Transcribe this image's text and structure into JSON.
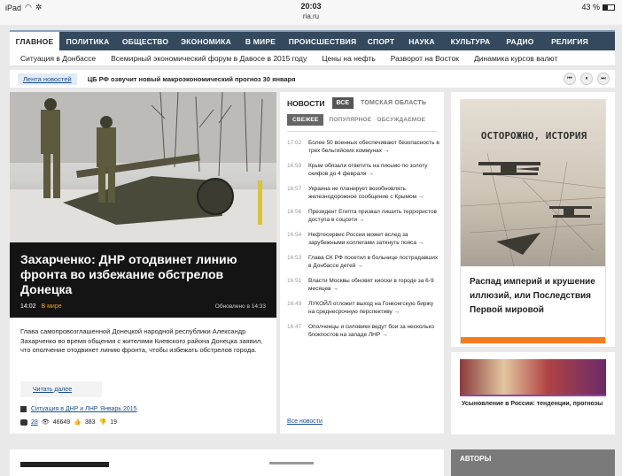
{
  "status_bar": {
    "device": "iPad",
    "time": "20:03",
    "url": "ria.ru",
    "battery": "43 %"
  },
  "main_nav": [
    {
      "label": "ГЛАВНОЕ",
      "active": true
    },
    {
      "label": "ПОЛИТИКА"
    },
    {
      "label": "ОБЩЕСТВО"
    },
    {
      "label": "ЭКОНОМИКА"
    },
    {
      "label": "В МИРЕ"
    },
    {
      "label": "ПРОИСШЕСТВИЯ"
    },
    {
      "label": "СПОРТ"
    },
    {
      "label": "НАУКА"
    },
    {
      "label": "КУЛЬТУРА"
    },
    {
      "label": "РАДИО"
    },
    {
      "label": "РЕЛИГИЯ"
    }
  ],
  "sub_nav": [
    "Ситуация в Донбассе",
    "Всемирный экономический форум в Давосе в 2015 году",
    "Цены на нефть",
    "Разворот на Восток",
    "Динамика курсов валют"
  ],
  "ticker": {
    "tab_label": "Лента новостей",
    "headline": "ЦБ РФ озвучит новый макроэкономический прогноз 30 января"
  },
  "lead_story": {
    "title": "Захарченко: ДНР отодвинет линию фронта во избежание обстрелов Донецка",
    "time": "14:02",
    "rubric": "В мире",
    "updated": "Обновлено в 14:33",
    "summary": "Глава самопровозглашенной Донецкой народной республики Александр Захарченко во время общения с жителями Киевского района Донецка заявил, что ополчение отодвинет линию фронта, чтобы избежать обстрелов города.",
    "read_more": "Читать далее",
    "story_link": "Ситуация в ДНР и ЛНР. Январь 2015",
    "comments": "28",
    "views": "46649",
    "likes": "383",
    "dislikes": "19"
  },
  "news_column": {
    "title": "НОВОСТИ",
    "all_label": "ВСЕ",
    "region_label": "ТОМСКАЯ ОБЛАСТЬ",
    "filters": [
      "СВЕЖЕЕ",
      "ПОПУЛЯРНОЕ",
      "ОБСУЖДАЕМОЕ"
    ],
    "items": [
      {
        "time": "17:02",
        "text": "Более 50 военных обеспечивают безопасность в трех бельгийских коммунах →"
      },
      {
        "time": "16:59",
        "text": "Крым обязали ответить на письмо по золоту скифов до 4 февраля →"
      },
      {
        "time": "16:57",
        "text": "Украина не планирует возобновлять железнодорожное сообщение с Крымом →"
      },
      {
        "time": "16:56",
        "text": "Президент Египта призвал лишить террористов доступа в соцсети →"
      },
      {
        "time": "16:54",
        "text": "Нефтесервис России может вслед за зарубежными коллегами затянуть пояса →"
      },
      {
        "time": "16:53",
        "text": "Глава СК РФ посетил в больнице пострадавших в Донбассе детей →"
      },
      {
        "time": "16:51",
        "text": "Власти Москвы обновят киоски в городе за 6-9 месяцев →"
      },
      {
        "time": "16:49",
        "text": "ЛУКОЙЛ отложит выход на Гонконгскую биржу на среднесрочную перспективу →"
      },
      {
        "time": "16:47",
        "text": "Ополченцы и силовики ведут бои за несколько блокпостов на западе ЛНР →"
      }
    ],
    "all_news": "Все новости"
  },
  "ad": {
    "heading": "ОСТОРОЖНО, ИСТОРИЯ",
    "body": "Распад империй и крушение иллюзий, или Последствия Первой мировой"
  },
  "promo": {
    "caption": "Усыновление в России: тенденции, прогнозы"
  },
  "authors": {
    "label": "АВТОРЫ"
  }
}
